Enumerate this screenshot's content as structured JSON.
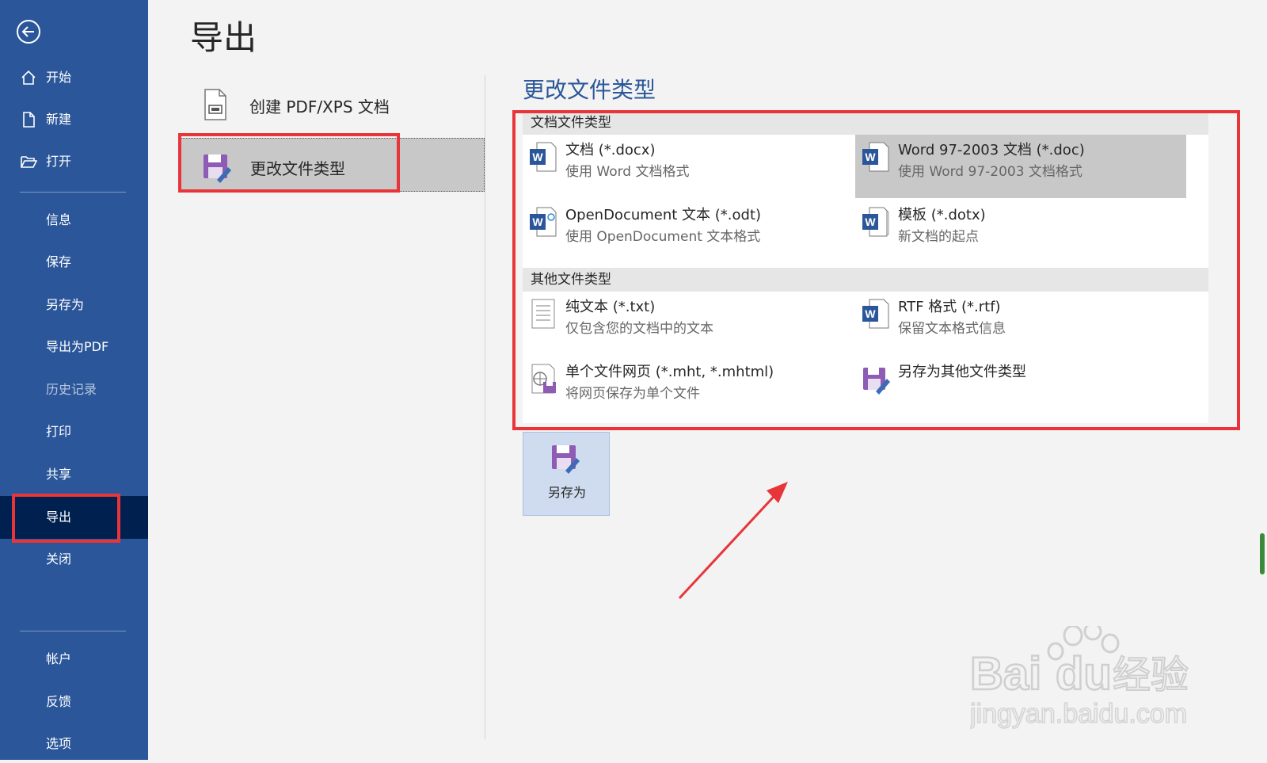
{
  "sidebar": {
    "items": [
      {
        "label": "开始",
        "icon": "home-icon"
      },
      {
        "label": "新建",
        "icon": "new-document-icon"
      },
      {
        "label": "打开",
        "icon": "folder-open-icon"
      },
      {
        "label": "信息"
      },
      {
        "label": "保存"
      },
      {
        "label": "另存为"
      },
      {
        "label": "导出为PDF"
      },
      {
        "label": "历史记录",
        "disabled": true
      },
      {
        "label": "打印"
      },
      {
        "label": "共享"
      },
      {
        "label": "导出",
        "active": true
      },
      {
        "label": "关闭"
      },
      {
        "label": "帐户"
      },
      {
        "label": "反馈"
      },
      {
        "label": "选项"
      }
    ]
  },
  "page": {
    "title": "导出"
  },
  "export_options": [
    {
      "label": "创建 PDF/XPS 文档",
      "icon": "pdf-document-icon"
    },
    {
      "label": "更改文件类型",
      "icon": "save-as-file-type-icon",
      "selected": true
    }
  ],
  "change_type": {
    "title": "更改文件类型",
    "groups": [
      {
        "header": "文档文件类型",
        "items": [
          {
            "title": "文档 (*.docx)",
            "desc": "使用 Word 文档格式",
            "icon": "word-document-icon"
          },
          {
            "title": "Word 97-2003 文档 (*.doc)",
            "desc": "使用 Word 97-2003 文档格式",
            "icon": "word-97-2003-icon",
            "selected": true
          },
          {
            "title": "OpenDocument 文本 (*.odt)",
            "desc": "使用 OpenDocument 文本格式",
            "icon": "opendocument-text-icon"
          },
          {
            "title": "模板 (*.dotx)",
            "desc": "新文档的起点",
            "icon": "word-template-icon"
          }
        ]
      },
      {
        "header": "其他文件类型",
        "items": [
          {
            "title": "纯文本 (*.txt)",
            "desc": "仅包含您的文档中的文本",
            "icon": "plain-text-icon"
          },
          {
            "title": "RTF 格式 (*.rtf)",
            "desc": "保留文本格式信息",
            "icon": "rtf-document-icon"
          },
          {
            "title": "单个文件网页 (*.mht, *.mhtml)",
            "desc": "将网页保存为单个文件",
            "icon": "web-page-icon"
          },
          {
            "title": "另存为其他文件类型",
            "desc": "",
            "icon": "save-as-other-icon"
          }
        ]
      }
    ]
  },
  "save_as_button": {
    "label": "另存为"
  },
  "watermark": {
    "line1": "Bai",
    "line2": "du",
    "line3": "经验",
    "url": "jingyan.baidu.com"
  },
  "colors": {
    "sidebar": "#2b579a",
    "active_nav": "#002050",
    "highlight": "#e8353a",
    "title_blue": "#2b579a",
    "selected": "#c8c8c8"
  }
}
